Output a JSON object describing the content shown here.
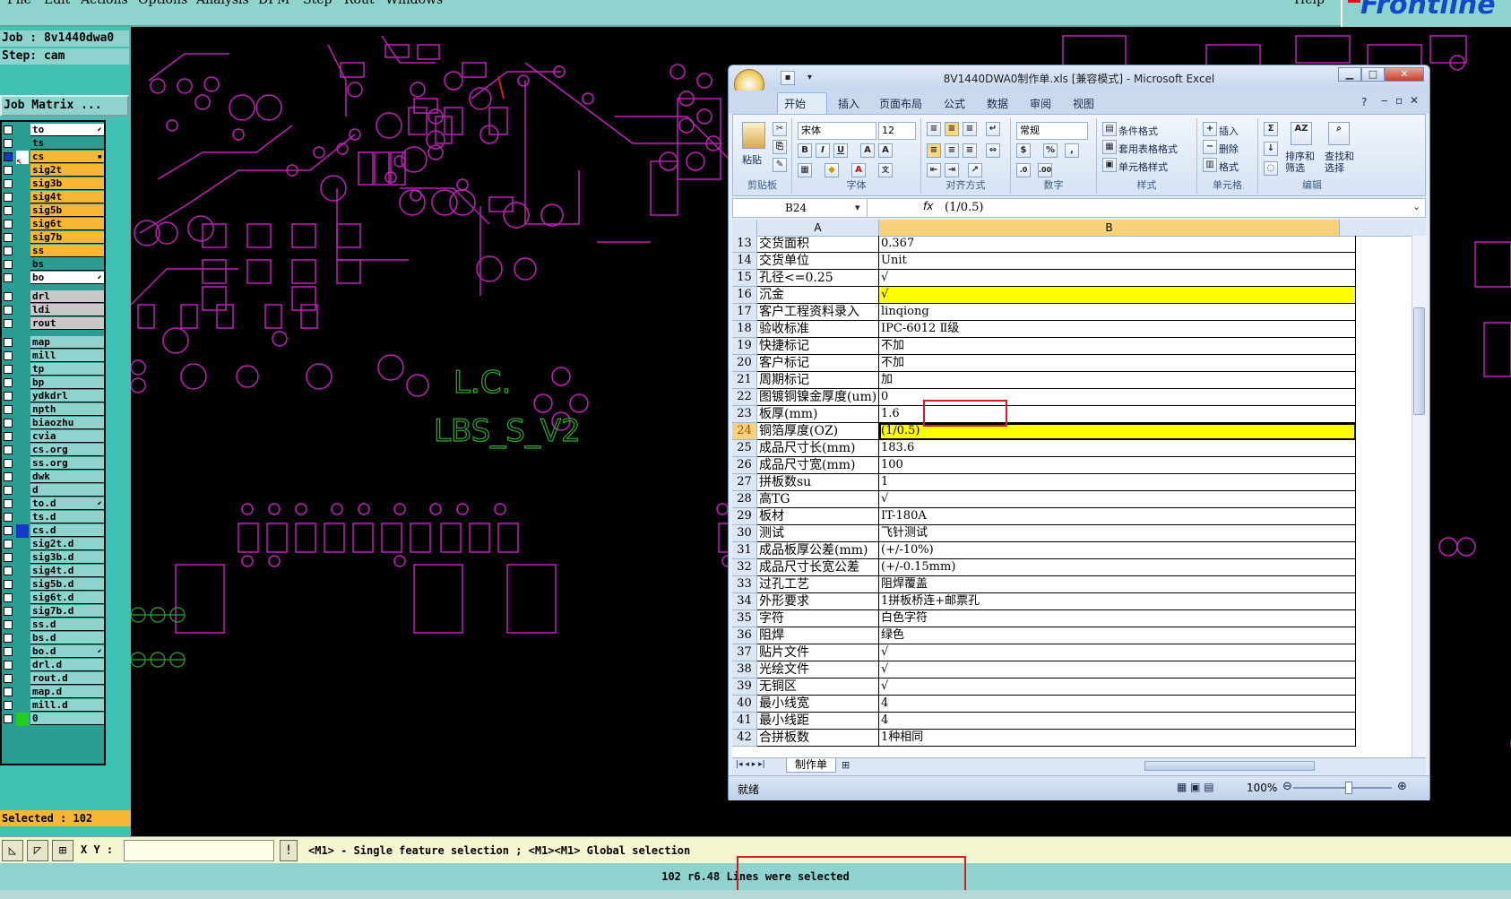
{
  "menubar": {
    "items": [
      "File",
      "Edit",
      "Actions",
      "Options",
      "Analysis",
      "DFM",
      "Step",
      "Rout",
      "Windows"
    ],
    "help": "Help"
  },
  "logo": {
    "text": "Frontline"
  },
  "jobinfo": {
    "job": "Job : 8v1440dwa0",
    "step": "Step: cam",
    "matrix": "Job Matrix ..."
  },
  "layers": [
    {
      "name": "to",
      "color": "#ffffff",
      "mark": "⬋"
    },
    {
      "name": "ts",
      "color": "#2c9d93",
      "mark": ""
    },
    {
      "name": "cs",
      "color": "#f7b733",
      "mark": "▪"
    },
    {
      "name": "sig2t",
      "color": "#f7b733",
      "mark": ""
    },
    {
      "name": "sig3b",
      "color": "#f7b733",
      "mark": ""
    },
    {
      "name": "sig4t",
      "color": "#f7b733",
      "mark": ""
    },
    {
      "name": "sig5b",
      "color": "#f7b733",
      "mark": ""
    },
    {
      "name": "sig6t",
      "color": "#f7b733",
      "mark": ""
    },
    {
      "name": "sig7b",
      "color": "#f7b733",
      "mark": ""
    },
    {
      "name": "ss",
      "color": "#f7b733",
      "mark": ""
    },
    {
      "name": "bs",
      "color": "#2c9d93",
      "mark": ""
    },
    {
      "name": "bo",
      "color": "#ffffff",
      "mark": "⬋"
    },
    {
      "name": "drl",
      "color": "#c8c8c8",
      "mark": ""
    },
    {
      "name": "ldi",
      "color": "#c8c8c8",
      "mark": ""
    },
    {
      "name": "rout",
      "color": "#c8c8c8",
      "mark": ""
    },
    {
      "name": "map",
      "color": "#8fd3cf",
      "mark": ""
    },
    {
      "name": "mill",
      "color": "#8fd3cf",
      "mark": ""
    },
    {
      "name": "tp",
      "color": "#8fd3cf",
      "mark": ""
    },
    {
      "name": "bp",
      "color": "#8fd3cf",
      "mark": ""
    },
    {
      "name": "ydkdrl",
      "color": "#8fd3cf",
      "mark": ""
    },
    {
      "name": "npth",
      "color": "#8fd3cf",
      "mark": ""
    },
    {
      "name": "biaozhu",
      "color": "#8fd3cf",
      "mark": ""
    },
    {
      "name": "cvia",
      "color": "#8fd3cf",
      "mark": ""
    },
    {
      "name": "cs.org",
      "color": "#8fd3cf",
      "mark": ""
    },
    {
      "name": "ss.org",
      "color": "#8fd3cf",
      "mark": ""
    },
    {
      "name": "dwk",
      "color": "#8fd3cf",
      "mark": ""
    },
    {
      "name": "d",
      "color": "#8fd3cf",
      "mark": ""
    },
    {
      "name": "to.d",
      "color": "#8fd3cf",
      "mark": "⬋"
    },
    {
      "name": "ts.d",
      "color": "#8fd3cf",
      "mark": ""
    },
    {
      "name": "cs.d",
      "color": "#8fd3cf",
      "mark": ""
    },
    {
      "name": "sig2t.d",
      "color": "#8fd3cf",
      "mark": ""
    },
    {
      "name": "sig3b.d",
      "color": "#8fd3cf",
      "mark": ""
    },
    {
      "name": "sig4t.d",
      "color": "#8fd3cf",
      "mark": ""
    },
    {
      "name": "sig5b.d",
      "color": "#8fd3cf",
      "mark": ""
    },
    {
      "name": "sig6t.d",
      "color": "#8fd3cf",
      "mark": ""
    },
    {
      "name": "sig7b.d",
      "color": "#8fd3cf",
      "mark": ""
    },
    {
      "name": "ss.d",
      "color": "#8fd3cf",
      "mark": ""
    },
    {
      "name": "bs.d",
      "color": "#8fd3cf",
      "mark": ""
    },
    {
      "name": "bo.d",
      "color": "#8fd3cf",
      "mark": "⬋"
    },
    {
      "name": "drl.d",
      "color": "#8fd3cf",
      "mark": ""
    },
    {
      "name": "rout.d",
      "color": "#8fd3cf",
      "mark": ""
    },
    {
      "name": "map.d",
      "color": "#8fd3cf",
      "mark": ""
    },
    {
      "name": "mill.d",
      "color": "#8fd3cf",
      "mark": ""
    },
    {
      "name": "0",
      "color": "#8fd3cf",
      "mark": ""
    }
  ],
  "selected": "Selected : 102",
  "statusbar": {
    "xy_label": "X Y :",
    "xy_value": "",
    "hint": "<M1> - Single feature selection ; <M1><M1> Global selection",
    "message": "102 r6.48 Lines were selected"
  },
  "cam": {
    "text1": "L.C.",
    "text2": "LBS_S_V2"
  },
  "excel": {
    "title": "8V1440DWA0制作单.xls [兼容模式] - Microsoft Excel",
    "tabs": [
      "开始",
      "插入",
      "页面布局",
      "公式",
      "数据",
      "审阅",
      "视图"
    ],
    "ribbon": {
      "paste": "粘贴",
      "font_name": "宋体",
      "font_size": "12",
      "number_format": "常规",
      "cond_format": "条件格式",
      "table_format": "套用表格格式",
      "cell_style": "单元格样式",
      "insert": "插入",
      "delete": "删除",
      "format": "格式",
      "sort": "排序和筛选",
      "find": "查找和选择",
      "groups": [
        "剪贴板",
        "字体",
        "对齐方式",
        "数字",
        "样式",
        "单元格",
        "编辑"
      ]
    },
    "namebox": "B24",
    "formula": "(1/0.5)",
    "col_headers": [
      "A",
      "B"
    ],
    "rows": [
      {
        "n": "13",
        "a": "交货面积",
        "b": "0.367",
        "hl": false
      },
      {
        "n": "14",
        "a": "交货单位",
        "b": "Unit",
        "hl": false
      },
      {
        "n": "15",
        "a": "孔径<=0.25",
        "b": "√",
        "hl": false
      },
      {
        "n": "16",
        "a": "沉金",
        "b": "√",
        "hl": true
      },
      {
        "n": "17",
        "a": "客户工程资料录入",
        "b": "linqiong",
        "hl": false
      },
      {
        "n": "18",
        "a": "验收标准",
        "b": "IPC-6012 Ⅱ级",
        "hl": false
      },
      {
        "n": "19",
        "a": "快捷标记",
        "b": "不加",
        "hl": false
      },
      {
        "n": "20",
        "a": "客户标记",
        "b": "不加",
        "hl": false
      },
      {
        "n": "21",
        "a": "周期标记",
        "b": "加",
        "hl": false
      },
      {
        "n": "22",
        "a": "图镀铜镍金厚度(um)",
        "b": "0",
        "hl": false
      },
      {
        "n": "23",
        "a": "板厚(mm)",
        "b": "1.6",
        "hl": false
      },
      {
        "n": "24",
        "a": "铜箔厚度(OZ)",
        "b": "(1/0.5)",
        "hl": true,
        "sel": true
      },
      {
        "n": "25",
        "a": "成品尺寸长(mm)",
        "b": "183.6",
        "hl": false
      },
      {
        "n": "26",
        "a": "成品尺寸宽(mm)",
        "b": "100",
        "hl": false
      },
      {
        "n": "27",
        "a": "拼板数su",
        "b": "1",
        "hl": false
      },
      {
        "n": "28",
        "a": "高TG",
        "b": "√",
        "hl": false
      },
      {
        "n": "29",
        "a": "板材",
        "b": "IT-180A",
        "hl": false
      },
      {
        "n": "30",
        "a": "测试",
        "b": "飞针测试",
        "hl": false
      },
      {
        "n": "31",
        "a": "成品板厚公差(mm)",
        "b": "(+/-10%)",
        "hl": false
      },
      {
        "n": "32",
        "a": "成品尺寸长宽公差",
        "b": "(+/-0.15mm)",
        "hl": false
      },
      {
        "n": "33",
        "a": "过孔工艺",
        "b": "阻焊覆盖",
        "hl": false
      },
      {
        "n": "34",
        "a": "外形要求",
        "b": "1拼板桥连+邮票孔",
        "hl": false
      },
      {
        "n": "35",
        "a": "字符",
        "b": "白色字符",
        "hl": false
      },
      {
        "n": "36",
        "a": "阻焊",
        "b": "绿色",
        "hl": false
      },
      {
        "n": "37",
        "a": "贴片文件",
        "b": "√",
        "hl": false
      },
      {
        "n": "38",
        "a": "光绘文件",
        "b": "√",
        "hl": false
      },
      {
        "n": "39",
        "a": "无铜区",
        "b": "√",
        "hl": false
      },
      {
        "n": "40",
        "a": "最小线宽",
        "b": "4",
        "hl": false
      },
      {
        "n": "41",
        "a": "最小线距",
        "b": "4",
        "hl": false
      },
      {
        "n": "42",
        "a": "合拼板数",
        "b": "1种相同",
        "hl": false
      }
    ],
    "sheet_tab": "制作单",
    "status": "就绪",
    "zoom": "100%"
  }
}
